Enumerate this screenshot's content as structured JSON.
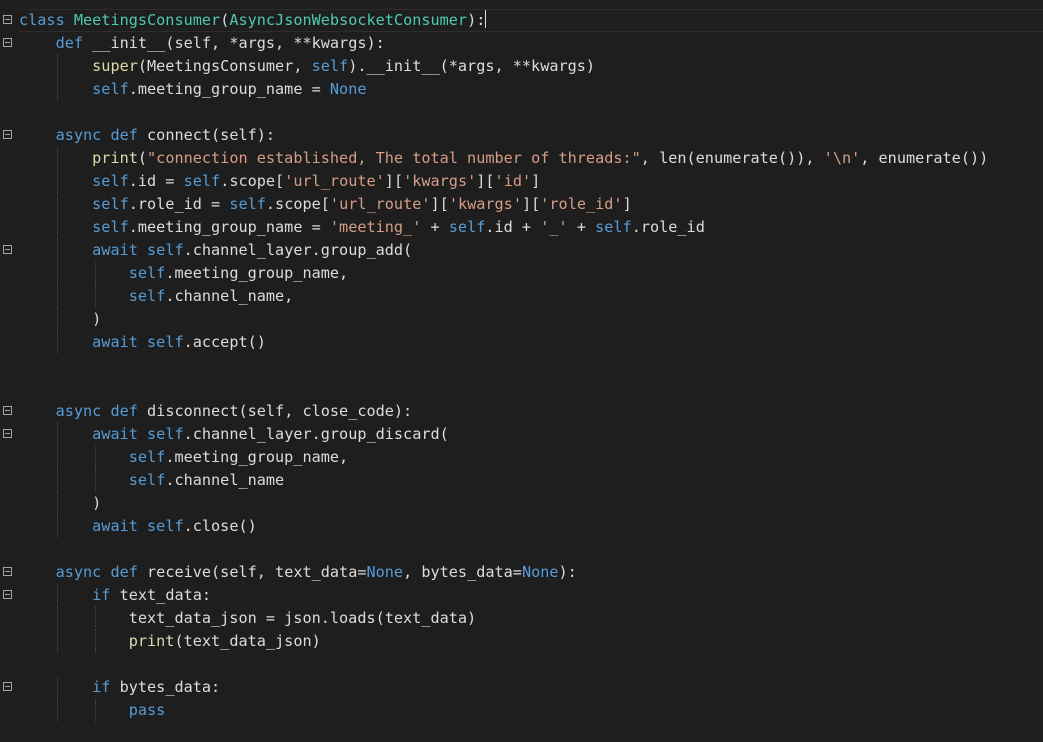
{
  "editor": {
    "language": "python",
    "theme": {
      "background": "#1e1e1e",
      "default": "#dcdcdc",
      "keyword": "#569cd6",
      "class": "#4ec9b0",
      "function": "#dcdcaa",
      "string": "#d69d85"
    },
    "lines": [
      {
        "fold": true,
        "tokens": [
          [
            "keyword",
            "class"
          ],
          [
            "default",
            " "
          ],
          [
            "class",
            "MeetingsConsumer"
          ],
          [
            "default",
            "("
          ],
          [
            "class",
            "AsyncJsonWebsocketConsumer"
          ],
          [
            "default",
            "):"
          ]
        ],
        "caret": true
      },
      {
        "fold": true,
        "tokens": [
          [
            "default",
            "    "
          ],
          [
            "keyword",
            "def"
          ],
          [
            "default",
            " "
          ],
          [
            "default",
            "__init__(self, *args, **kwargs):"
          ]
        ]
      },
      {
        "fold": false,
        "tokens": [
          [
            "default",
            "        "
          ],
          [
            "func",
            "super"
          ],
          [
            "default",
            "(MeetingsConsumer, "
          ],
          [
            "self",
            "self"
          ],
          [
            "default",
            ").__init__(*args, **kwargs)"
          ]
        ]
      },
      {
        "fold": false,
        "tokens": [
          [
            "default",
            "        "
          ],
          [
            "self",
            "self"
          ],
          [
            "default",
            ".meeting_group_name = "
          ],
          [
            "keyword",
            "None"
          ]
        ]
      },
      {
        "fold": false,
        "tokens": []
      },
      {
        "fold": true,
        "tokens": [
          [
            "default",
            "    "
          ],
          [
            "keyword",
            "async"
          ],
          [
            "default",
            " "
          ],
          [
            "keyword",
            "def"
          ],
          [
            "default",
            " connect(self):"
          ]
        ]
      },
      {
        "fold": false,
        "tokens": [
          [
            "default",
            "        "
          ],
          [
            "func",
            "print"
          ],
          [
            "default",
            "("
          ],
          [
            "string",
            "\"connection established, The total number of threads:\""
          ],
          [
            "default",
            ", len(enumerate()), "
          ],
          [
            "string",
            "'\\n'"
          ],
          [
            "default",
            ", enumerate())"
          ]
        ]
      },
      {
        "fold": false,
        "tokens": [
          [
            "default",
            "        "
          ],
          [
            "self",
            "self"
          ],
          [
            "default",
            ".id = "
          ],
          [
            "self",
            "self"
          ],
          [
            "default",
            ".scope["
          ],
          [
            "string",
            "'url_route'"
          ],
          [
            "default",
            "]["
          ],
          [
            "string",
            "'kwargs'"
          ],
          [
            "default",
            "]["
          ],
          [
            "string",
            "'id'"
          ],
          [
            "default",
            "]"
          ]
        ]
      },
      {
        "fold": false,
        "tokens": [
          [
            "default",
            "        "
          ],
          [
            "self",
            "self"
          ],
          [
            "default",
            ".role_id = "
          ],
          [
            "self",
            "self"
          ],
          [
            "default",
            ".scope["
          ],
          [
            "string",
            "'url_route'"
          ],
          [
            "default",
            "]["
          ],
          [
            "string",
            "'kwargs'"
          ],
          [
            "default",
            "]["
          ],
          [
            "string",
            "'role_id'"
          ],
          [
            "default",
            "]"
          ]
        ]
      },
      {
        "fold": false,
        "tokens": [
          [
            "default",
            "        "
          ],
          [
            "self",
            "self"
          ],
          [
            "default",
            ".meeting_group_name = "
          ],
          [
            "string",
            "'meeting_'"
          ],
          [
            "default",
            " + "
          ],
          [
            "self",
            "self"
          ],
          [
            "default",
            ".id + "
          ],
          [
            "string",
            "'_'"
          ],
          [
            "default",
            " + "
          ],
          [
            "self",
            "self"
          ],
          [
            "default",
            ".role_id"
          ]
        ]
      },
      {
        "fold": true,
        "tokens": [
          [
            "default",
            "        "
          ],
          [
            "keyword",
            "await"
          ],
          [
            "default",
            " "
          ],
          [
            "self",
            "self"
          ],
          [
            "default",
            ".channel_layer.group_add("
          ]
        ]
      },
      {
        "fold": false,
        "tokens": [
          [
            "default",
            "            "
          ],
          [
            "self",
            "self"
          ],
          [
            "default",
            ".meeting_group_name,"
          ]
        ]
      },
      {
        "fold": false,
        "tokens": [
          [
            "default",
            "            "
          ],
          [
            "self",
            "self"
          ],
          [
            "default",
            ".channel_name,"
          ]
        ]
      },
      {
        "fold": false,
        "tokens": [
          [
            "default",
            "        )"
          ]
        ]
      },
      {
        "fold": false,
        "tokens": [
          [
            "default",
            "        "
          ],
          [
            "keyword",
            "await"
          ],
          [
            "default",
            " "
          ],
          [
            "self",
            "self"
          ],
          [
            "default",
            ".accept()"
          ]
        ]
      },
      {
        "fold": false,
        "tokens": []
      },
      {
        "fold": false,
        "tokens": []
      },
      {
        "fold": true,
        "tokens": [
          [
            "default",
            "    "
          ],
          [
            "keyword",
            "async"
          ],
          [
            "default",
            " "
          ],
          [
            "keyword",
            "def"
          ],
          [
            "default",
            " disconnect(self, close_code):"
          ]
        ]
      },
      {
        "fold": true,
        "tokens": [
          [
            "default",
            "        "
          ],
          [
            "keyword",
            "await"
          ],
          [
            "default",
            " "
          ],
          [
            "self",
            "self"
          ],
          [
            "default",
            ".channel_layer.group_discard("
          ]
        ]
      },
      {
        "fold": false,
        "tokens": [
          [
            "default",
            "            "
          ],
          [
            "self",
            "self"
          ],
          [
            "default",
            ".meeting_group_name,"
          ]
        ]
      },
      {
        "fold": false,
        "tokens": [
          [
            "default",
            "            "
          ],
          [
            "self",
            "self"
          ],
          [
            "default",
            ".channel_name"
          ]
        ]
      },
      {
        "fold": false,
        "tokens": [
          [
            "default",
            "        )"
          ]
        ]
      },
      {
        "fold": false,
        "tokens": [
          [
            "default",
            "        "
          ],
          [
            "keyword",
            "await"
          ],
          [
            "default",
            " "
          ],
          [
            "self",
            "self"
          ],
          [
            "default",
            ".close()"
          ]
        ]
      },
      {
        "fold": false,
        "tokens": []
      },
      {
        "fold": true,
        "tokens": [
          [
            "default",
            "    "
          ],
          [
            "keyword",
            "async"
          ],
          [
            "default",
            " "
          ],
          [
            "keyword",
            "def"
          ],
          [
            "default",
            " receive(self, text_data="
          ],
          [
            "keyword",
            "None"
          ],
          [
            "default",
            ", bytes_data="
          ],
          [
            "keyword",
            "None"
          ],
          [
            "default",
            "):"
          ]
        ]
      },
      {
        "fold": true,
        "tokens": [
          [
            "default",
            "        "
          ],
          [
            "keyword",
            "if"
          ],
          [
            "default",
            " text_data:"
          ]
        ]
      },
      {
        "fold": false,
        "tokens": [
          [
            "default",
            "            text_data_json = json.loads(text_data)"
          ]
        ]
      },
      {
        "fold": false,
        "tokens": [
          [
            "default",
            "            "
          ],
          [
            "func",
            "print"
          ],
          [
            "default",
            "(text_data_json)"
          ]
        ]
      },
      {
        "fold": false,
        "tokens": []
      },
      {
        "fold": true,
        "tokens": [
          [
            "default",
            "        "
          ],
          [
            "keyword",
            "if"
          ],
          [
            "default",
            " bytes_data:"
          ]
        ]
      },
      {
        "fold": false,
        "tokens": [
          [
            "default",
            "            "
          ],
          [
            "keyword",
            "pass"
          ]
        ]
      },
      {
        "fold": false,
        "tokens": []
      }
    ]
  }
}
